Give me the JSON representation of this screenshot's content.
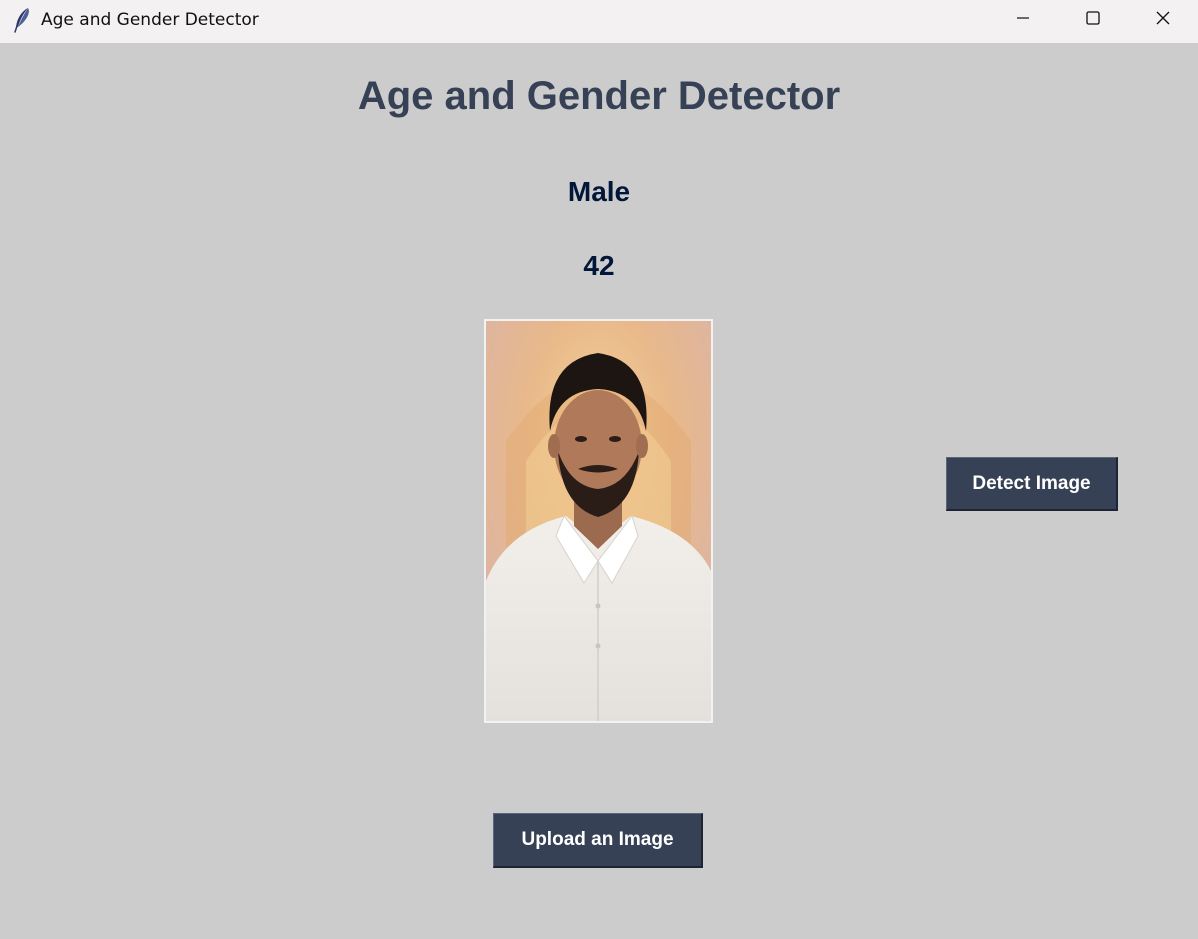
{
  "window": {
    "title": "Age and Gender Detector",
    "icon": "feather-icon",
    "controls": [
      "minimize-icon",
      "maximize-icon",
      "close-icon"
    ]
  },
  "main": {
    "heading": "Age and Gender Detector",
    "gender": "Male",
    "age": "42",
    "photo": "portrait-photo"
  },
  "buttons": {
    "detect_label": "Detect Image",
    "upload_label": "Upload an Image"
  },
  "colors": {
    "background": "#cccccc",
    "heading": "#364156",
    "result_text": "#011638",
    "button_bg": "#364156",
    "button_text": "#ffffff"
  }
}
